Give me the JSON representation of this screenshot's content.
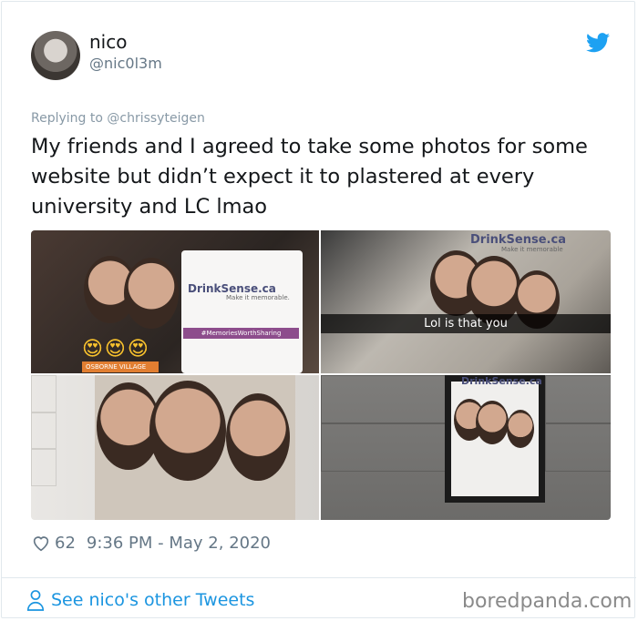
{
  "author": {
    "name": "nico",
    "handle": "@nic0l3m"
  },
  "tweet": {
    "replying_to": "Replying to @chrissyteigen",
    "text": "My friends and I agreed to take some photos for some website but didn’t expect it to plastered at every university and LC lmao",
    "likes": "62",
    "timestamp": "9:36 PM - May 2, 2020"
  },
  "media": {
    "photo1": {
      "brand": "DrinkSense.ca",
      "brand_sub": "Make it memorable.",
      "hashtag": "#MemoriesWorthSharing",
      "location": "OSBORNE VILLAGE",
      "emojis": "😍😍😍"
    },
    "photo2": {
      "brand": "DrinkSense.ca",
      "brand_sub": "Make it memorable",
      "caption": "Lol is that you"
    },
    "photo4": {
      "brand": "DrinkSense.ca"
    }
  },
  "footer": {
    "see_more": "See nico's other Tweets",
    "watermark": "boredpanda.com"
  },
  "colors": {
    "twitter_blue": "#1da1f2",
    "link_blue": "#1b95e0",
    "muted": "#657786"
  },
  "icons": [
    "twitter-bird-icon",
    "heart-icon",
    "person-icon"
  ]
}
